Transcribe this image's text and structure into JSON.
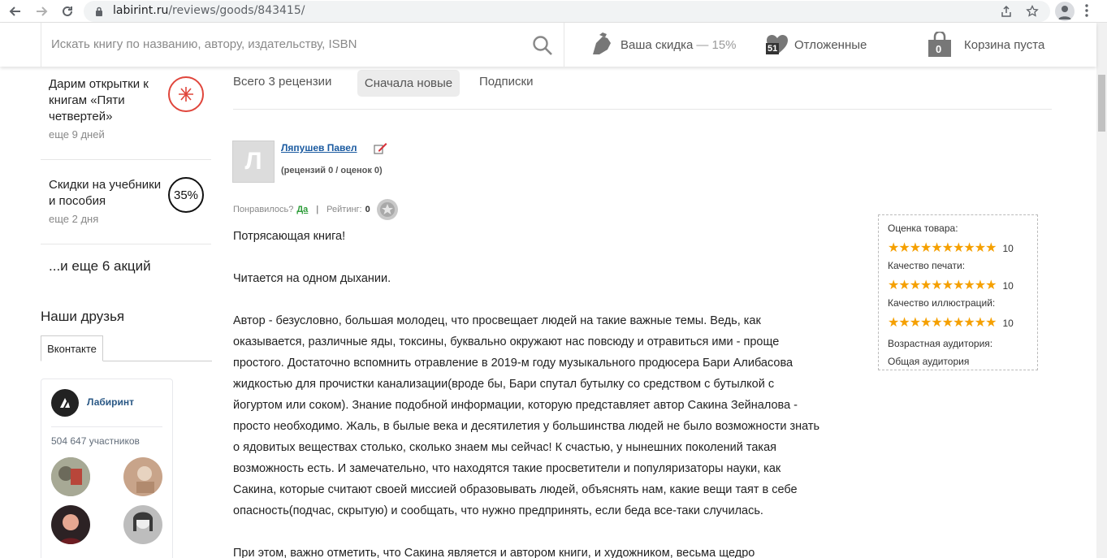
{
  "browser": {
    "url_host": "labirint.ru",
    "url_path": "/reviews/goods/843415/"
  },
  "header": {
    "search_placeholder": "Искать книгу по названию, автору, издательству, ISBN",
    "discount_label": "Ваша скидка",
    "discount_value": "— 15%",
    "wishlist_label": "Отложенные",
    "wishlist_count": "51",
    "cart_label": "Корзина пуста",
    "cart_count": "0"
  },
  "sidebar": {
    "promos": [
      {
        "title": "Дарим открытки к книгам «Пяти четвертей»",
        "sub": "еще 9 дней"
      },
      {
        "title": "Скидки на учебники и пособия",
        "sub": "еще 2 дня",
        "badge": "35%"
      }
    ],
    "more_actions": "...и еще 6 акций",
    "friends_title": "Наши друзья",
    "vk_tab": "Вконтакте",
    "vk_group_name": "Лабиринт",
    "vk_members": "504 647 участников"
  },
  "reviews_nav": {
    "total": "Всего 3 рецензии",
    "sort_label": "Сначала новые",
    "subscriptions": "Подписки"
  },
  "review": {
    "avatar_letter": "Л",
    "author": "Ляпушев Павел",
    "stats": "(рецензий 0 / оценок 0)",
    "helpful_label": "Понравилось?",
    "helpful_yes": "Да",
    "rating_label": "Рейтинг:",
    "rating_value": "0",
    "paragraphs": [
      "Потрясающая книга!",
      "Читается на одном дыхании.",
      "Автор - безусловно, большая молодец, что просвещает людей на такие важные темы. Ведь, как оказывается, различные яды, токсины, буквально окружают нас повсюду и отравиться ими - проще простого. Достаточно вспомнить отравление в 2019-м году музыкального продюсера Бари Алибасова жидкостью для прочистки канализации(вроде бы, Бари спутал бутылку со средством с бутылкой с йогуртом или соком). Знание подобной информации, которую представляет автор Сакина Зейналова - просто необходимо. Жаль, в былые века и десятилетия у большинства людей не было возможности знать о ядовитых веществах столько, сколько знаем мы сейчас! К счастью, у нынешних поколений такая возможность есть. И замечательно, что находятся такие просветители и популяризаторы науки, как Сакина, которые считают своей миссией образовывать людей, объяснять нам, какие вещи таят в себе опасность(подчас, скрытую) и сообщать, что нужно предпринять, если беда все-таки случилась.",
      "При этом, важно отметить, что Сакина является и автором книги, и художником, весьма щедро"
    ]
  },
  "ratings": {
    "items": [
      {
        "label": "Оценка товара:",
        "value": "10",
        "stars": 10
      },
      {
        "label": "Качество печати:",
        "value": "10",
        "stars": 10
      },
      {
        "label": "Качество иллюстраций:",
        "value": "10",
        "stars": 10
      }
    ],
    "audience_label": "Возрастная аудитория:",
    "audience_value": "Общая аудитория",
    "star_color": "#f5a000"
  }
}
